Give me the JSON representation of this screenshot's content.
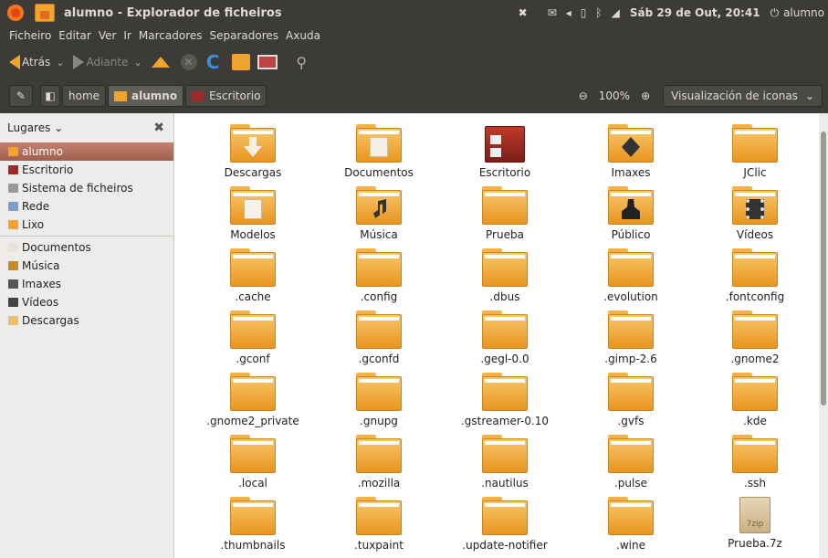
{
  "topbar": {
    "title": "alumno - Explorador de ficheiros",
    "clock": "Sáb 29 de Out, 20:41",
    "user": "alumno",
    "close": "✖"
  },
  "menu": [
    "Ficheiro",
    "Editar",
    "Ver",
    "Ir",
    "Marcadores",
    "Separadores",
    "Axuda"
  ],
  "toolbar": {
    "back": "Atrás",
    "forward": "Adiante"
  },
  "location": {
    "crumbs": [
      "home",
      "alumno",
      "Escritorio"
    ],
    "zoom": "100%",
    "view": "Visualización de iconas"
  },
  "sidebar": {
    "header": "Lugares",
    "items": [
      {
        "label": "alumno",
        "color": "#f0a32e",
        "selected": true
      },
      {
        "label": "Escritorio",
        "color": "#a02a2a"
      },
      {
        "label": "Sistema de ficheiros",
        "color": "#999999"
      },
      {
        "label": "Rede",
        "color": "#7aa0c8"
      },
      {
        "label": "Lixo",
        "color": "#f0a32e"
      }
    ],
    "bookmarks": [
      {
        "label": "Documentos",
        "color": "#e8e4dc"
      },
      {
        "label": "Música",
        "color": "#c58a2a"
      },
      {
        "label": "Imaxes",
        "color": "#555555"
      },
      {
        "label": "Vídeos",
        "color": "#444444"
      },
      {
        "label": "Descargas",
        "color": "#e8c070"
      }
    ]
  },
  "files": [
    {
      "name": "Descargas",
      "icon": "download"
    },
    {
      "name": "Documentos",
      "icon": "doc"
    },
    {
      "name": "Escritorio",
      "icon": "desktop"
    },
    {
      "name": "Imaxes",
      "icon": "camera"
    },
    {
      "name": "JClic",
      "icon": "folder"
    },
    {
      "name": "Modelos",
      "icon": "template"
    },
    {
      "name": "Música",
      "icon": "music"
    },
    {
      "name": "Prueba",
      "icon": "folder"
    },
    {
      "name": "Público",
      "icon": "person"
    },
    {
      "name": "Vídeos",
      "icon": "film"
    },
    {
      "name": ".cache",
      "icon": "folder"
    },
    {
      "name": ".config",
      "icon": "folder"
    },
    {
      "name": ".dbus",
      "icon": "folder"
    },
    {
      "name": ".evolution",
      "icon": "folder"
    },
    {
      "name": ".fontconfig",
      "icon": "folder"
    },
    {
      "name": ".gconf",
      "icon": "folder"
    },
    {
      "name": ".gconfd",
      "icon": "folder"
    },
    {
      "name": ".gegl-0.0",
      "icon": "folder"
    },
    {
      "name": ".gimp-2.6",
      "icon": "folder"
    },
    {
      "name": ".gnome2",
      "icon": "folder"
    },
    {
      "name": ".gnome2_private",
      "icon": "folder"
    },
    {
      "name": ".gnupg",
      "icon": "folder"
    },
    {
      "name": ".gstreamer-0.10",
      "icon": "folder"
    },
    {
      "name": ".gvfs",
      "icon": "folder"
    },
    {
      "name": ".kde",
      "icon": "folder"
    },
    {
      "name": ".local",
      "icon": "folder"
    },
    {
      "name": ".mozilla",
      "icon": "folder"
    },
    {
      "name": ".nautilus",
      "icon": "folder"
    },
    {
      "name": ".pulse",
      "icon": "folder"
    },
    {
      "name": ".ssh",
      "icon": "folder"
    },
    {
      "name": ".thumbnails",
      "icon": "folder"
    },
    {
      "name": ".tuxpaint",
      "icon": "folder"
    },
    {
      "name": ".update-notifier",
      "icon": "folder"
    },
    {
      "name": ".wine",
      "icon": "folder"
    },
    {
      "name": "Prueba.7z",
      "icon": "zip",
      "badge": "7zip"
    }
  ]
}
